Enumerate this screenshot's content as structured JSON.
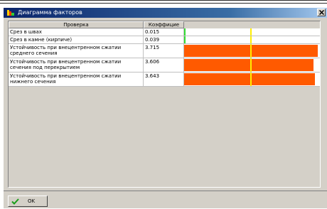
{
  "window": {
    "title": "Диаграмма факторов",
    "icon": "app-icon",
    "close_icon": "close-icon"
  },
  "table": {
    "columns": [
      "Проверка",
      "Коэффицие"
    ],
    "rows": [
      {
        "check": "Срез в швах",
        "coef": "0.015",
        "value": 0.015
      },
      {
        "check": "Срез в камне (кирпиче)",
        "coef": "0.039",
        "value": 0.039
      },
      {
        "check": "Устойчивость при внецентренном сжатии среднего сечения",
        "coef": "3.715",
        "value": 3.715
      },
      {
        "check": "Устойчивость при внецентренном сжатии сечения под перекрытием",
        "coef": "3.606",
        "value": 3.606
      },
      {
        "check": "Устойчивость при внецентренном сжатии нижнего сечения",
        "coef": "3.643",
        "value": 3.643
      }
    ],
    "bar_scale_max": 2.02,
    "limit_value": 1.0,
    "colors": {
      "bar": "#ff5a00",
      "small_value_mark": "#33dd33",
      "limit_line": "#ffee00"
    }
  },
  "buttons": {
    "ok_label": "OK",
    "ok_icon": "checkmark-icon"
  }
}
